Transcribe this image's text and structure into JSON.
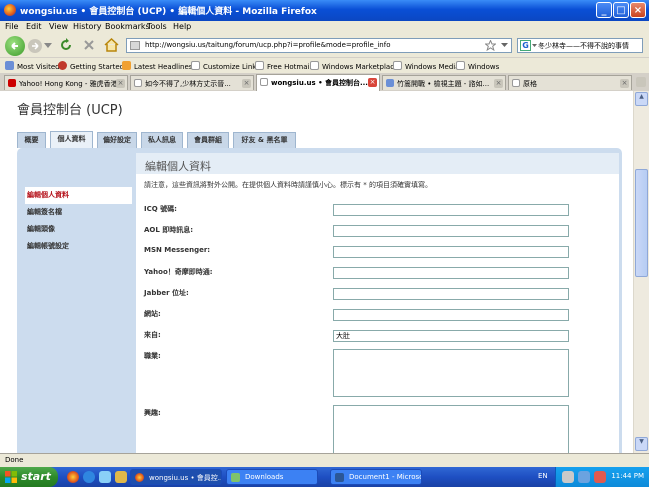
{
  "window": {
    "title": "wongsiu.us • 會員控制台 (UCP) • 編輯個人資料 - Mozilla Firefox",
    "minimize": "_",
    "maximize": "□",
    "close": "×"
  },
  "menu": [
    "File",
    "Edit",
    "View",
    "History",
    "Bookmarks",
    "Tools",
    "Help"
  ],
  "nav": {
    "url": "http://wongsiu.us/taitung/forum/ucp.php?i=profile&mode=profile_info",
    "search_text": "冬少林寺——不得不說的事情",
    "search_engine_letter": "G"
  },
  "bookmarks": [
    "Most Visited",
    "Getting Started",
    "Latest Headlines",
    "Customize Links",
    "Free Hotmail",
    "Windows Marketplace",
    "Windows Media",
    "Windows"
  ],
  "browser_tabs": [
    {
      "label": "Yahoo! Hong Kong - 雅虎香港",
      "selected": false
    },
    {
      "label": "如今不得了,少林方丈示晉...",
      "selected": false
    },
    {
      "label": "wongsiu.us • 會員控制台...",
      "selected": true
    },
    {
      "label": "竹篙開戰 • 檢視主題 - 諮如...",
      "selected": false
    },
    {
      "label": "原格",
      "selected": false
    }
  ],
  "page": {
    "title": "會員控制台 (UCP)",
    "tabs": [
      "概要",
      "個人資料",
      "偏好設定",
      "私人訊息",
      "會員群組",
      "好友 & 黑名單"
    ],
    "active_tab": "個人資料",
    "sidebar": [
      "編輯個人資料",
      "編輯簽名檔",
      "編輯頭像",
      "編輯帳號設定"
    ],
    "active_sidebar": "編輯個人資料",
    "form_title": "編輯個人資料",
    "notice": "請注意，這些資訊將對外公開。在提供個人資料時請謹慎小心。標示有 * 的項目須確實填寫。",
    "fields": [
      {
        "label": "ICQ 號碼:",
        "value": ""
      },
      {
        "label": "AOL 即時訊息:",
        "value": ""
      },
      {
        "label": "MSN Messenger:",
        "value": ""
      },
      {
        "label": "Yahoo！奇摩即時通:",
        "value": ""
      },
      {
        "label": "Jabber 位址:",
        "value": ""
      },
      {
        "label": "網站:",
        "value": ""
      },
      {
        "label": "來自:",
        "value": "大肚"
      }
    ],
    "textareas": [
      {
        "label": "職業:",
        "value": ""
      },
      {
        "label": "興趣:",
        "value": ""
      }
    ]
  },
  "status": "Done",
  "taskbar": {
    "start": "start",
    "tasks": [
      {
        "label": "wongsiu.us • 會員控...",
        "selected": true
      },
      {
        "label": "Downloads",
        "selected": false
      },
      {
        "label": "Document1 - Microsof...",
        "selected": false
      }
    ],
    "language": "EN",
    "clock": "11:44 PM"
  },
  "colors": {
    "titlebar": "#0a4fd6",
    "panel": "#ccdcee",
    "active_sidebar_text": "#b5121b",
    "taskbar": "#1e4fc2",
    "start": "#2d8a2a"
  }
}
